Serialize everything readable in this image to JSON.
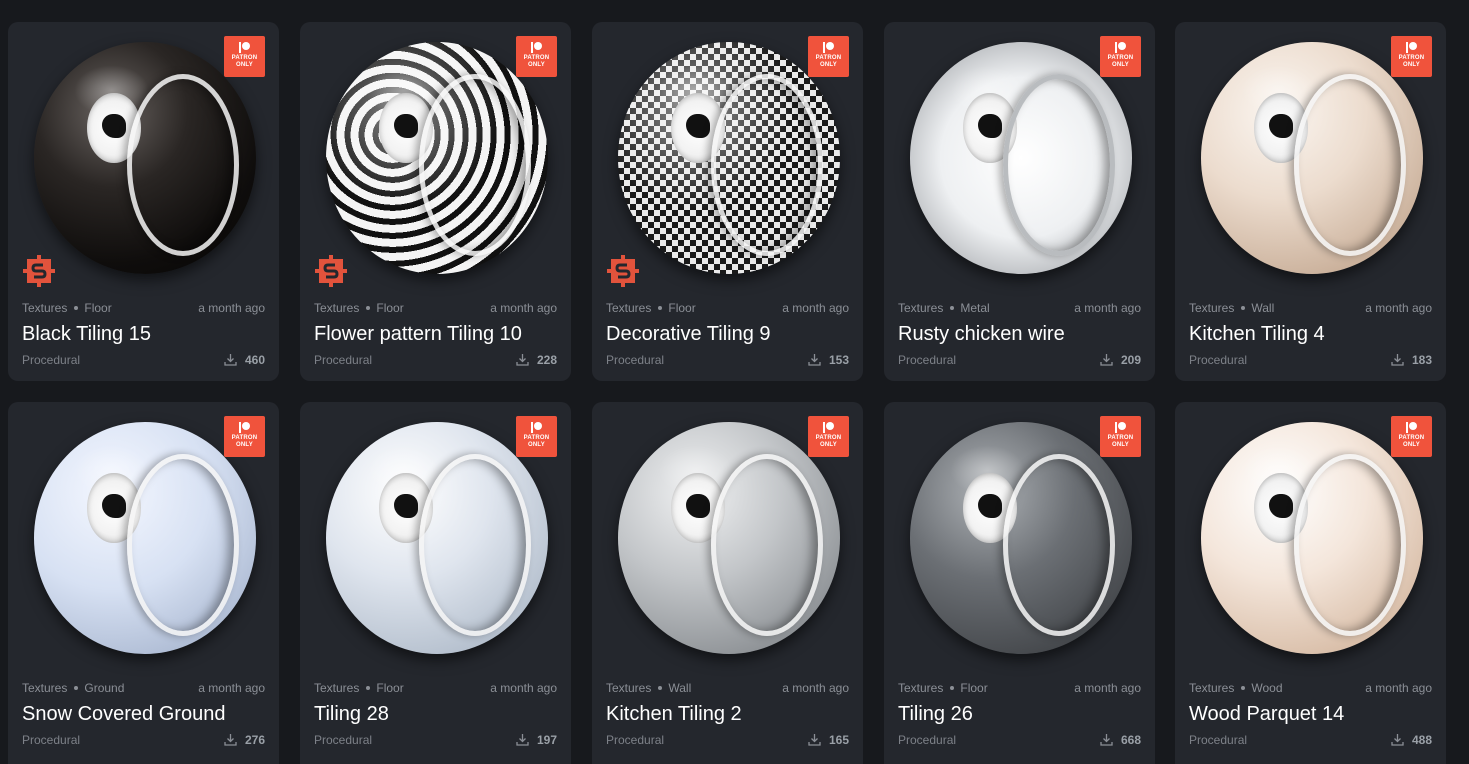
{
  "badge": {
    "line1": "PATRON",
    "line2": "ONLY"
  },
  "cards": [
    {
      "section": "Textures",
      "category": "Floor",
      "time": "a month ago",
      "title": "Black Tiling 15",
      "type": "Procedural",
      "downloads": "460",
      "substance": true,
      "material": "black-gloss"
    },
    {
      "section": "Textures",
      "category": "Floor",
      "time": "a month ago",
      "title": "Flower pattern Tiling 10",
      "type": "Procedural",
      "downloads": "228",
      "substance": true,
      "material": "flower-pattern"
    },
    {
      "section": "Textures",
      "category": "Floor",
      "time": "a month ago",
      "title": "Decorative Tiling 9",
      "type": "Procedural",
      "downloads": "153",
      "substance": true,
      "material": "decorative-checker"
    },
    {
      "section": "Textures",
      "category": "Metal",
      "time": "a month ago",
      "title": "Rusty chicken wire",
      "type": "Procedural",
      "downloads": "209",
      "substance": false,
      "material": "chicken-wire"
    },
    {
      "section": "Textures",
      "category": "Wall",
      "time": "a month ago",
      "title": "Kitchen Tiling 4",
      "type": "Procedural",
      "downloads": "183",
      "substance": false,
      "material": "beige-tile"
    },
    {
      "section": "Textures",
      "category": "Ground",
      "time": "a month ago",
      "title": "Snow Covered Ground",
      "type": "Procedural",
      "downloads": "276",
      "substance": false,
      "material": "snow"
    },
    {
      "section": "Textures",
      "category": "Floor",
      "time": "a month ago",
      "title": "Tiling 28",
      "type": "Procedural",
      "downloads": "197",
      "substance": false,
      "material": "marble-blue"
    },
    {
      "section": "Textures",
      "category": "Wall",
      "time": "a month ago",
      "title": "Kitchen Tiling 2",
      "type": "Procedural",
      "downloads": "165",
      "substance": false,
      "material": "grey-tile"
    },
    {
      "section": "Textures",
      "category": "Floor",
      "time": "a month ago",
      "title": "Tiling 26",
      "type": "Procedural",
      "downloads": "668",
      "substance": false,
      "material": "dark-stone"
    },
    {
      "section": "Textures",
      "category": "Wood",
      "time": "a month ago",
      "title": "Wood Parquet 14",
      "type": "Procedural",
      "downloads": "488",
      "substance": false,
      "material": "light-wood"
    }
  ],
  "colors": {
    "page_bg": "#17191d",
    "card_bg": "#24272d",
    "badge": "#f0533c"
  }
}
